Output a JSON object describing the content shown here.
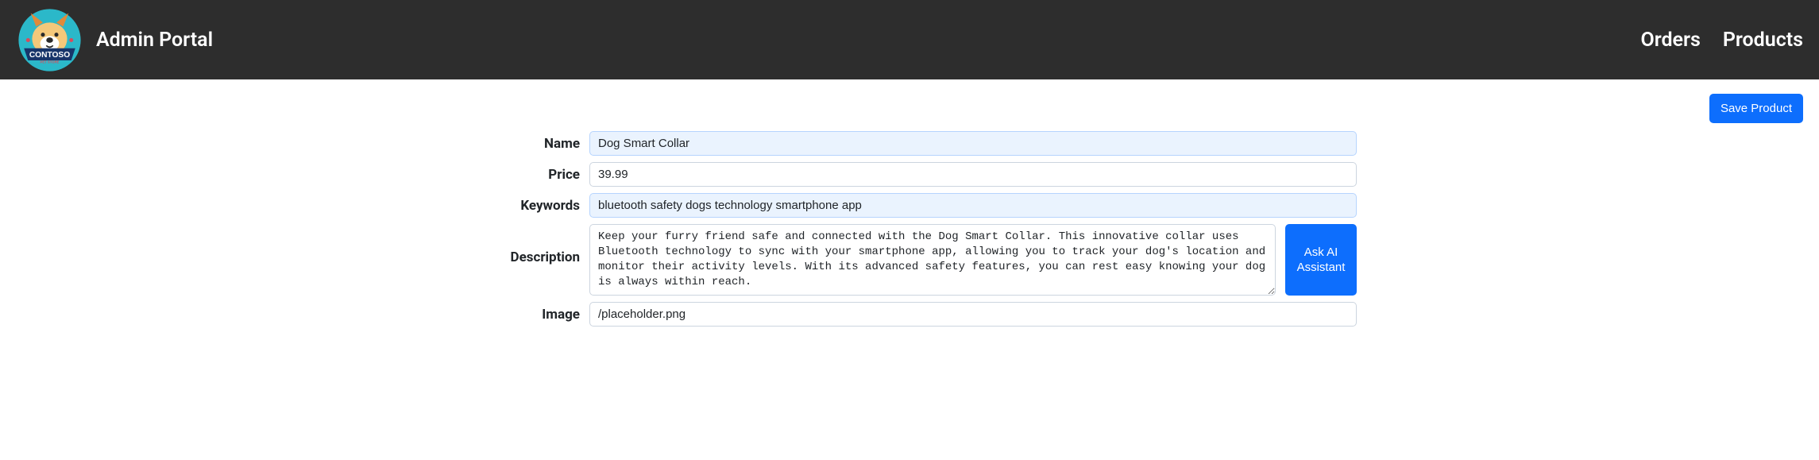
{
  "header": {
    "title": "Admin Portal",
    "nav": {
      "orders": "Orders",
      "products": "Products"
    }
  },
  "actions": {
    "save_label": "Save Product"
  },
  "form": {
    "name_label": "Name",
    "name_value": "Dog Smart Collar",
    "price_label": "Price",
    "price_value": "39.99",
    "keywords_label": "Keywords",
    "keywords_value": "bluetooth safety dogs technology smartphone app",
    "description_label": "Description",
    "description_value": "Keep your furry friend safe and connected with the Dog Smart Collar. This innovative collar uses Bluetooth technology to sync with your smartphone app, allowing you to track your dog's location and monitor their activity levels. With its advanced safety features, you can rest easy knowing your dog is always within reach.",
    "ask_ai_label": "Ask AI Assistant",
    "image_label": "Image",
    "image_value": "/placeholder.png"
  }
}
